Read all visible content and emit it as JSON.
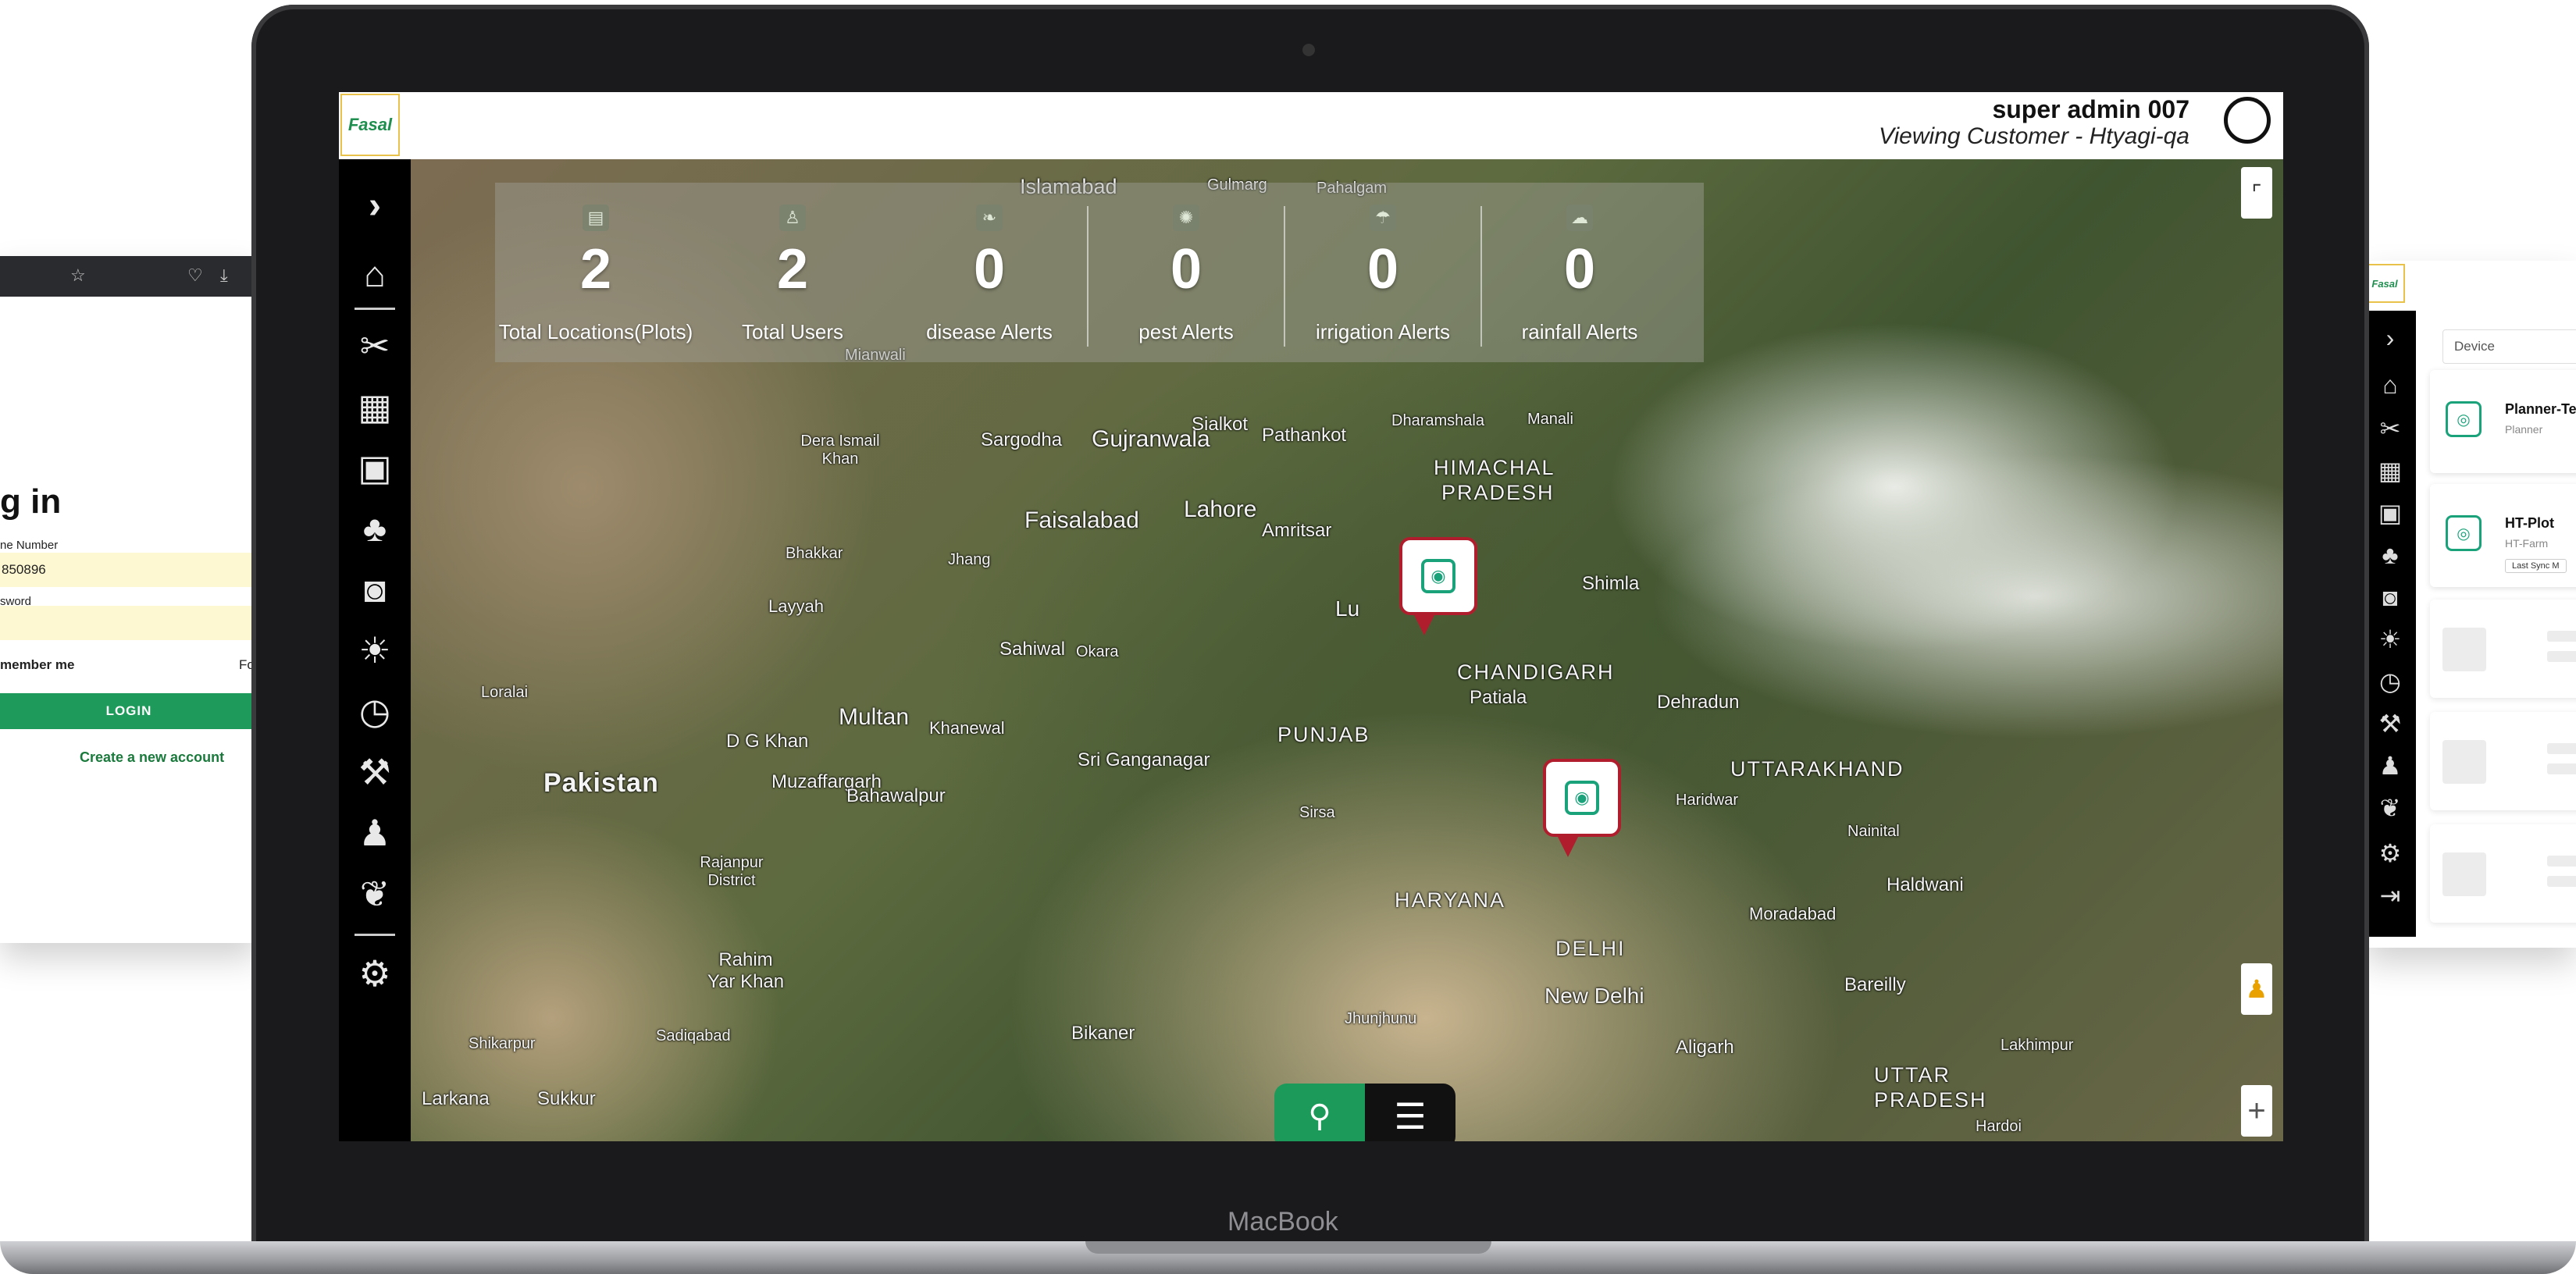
{
  "login": {
    "title": "g in",
    "phone_label": "ne Number",
    "phone_value": "850896",
    "password_label": "sword",
    "remember_label": "member me",
    "forgot_label": "Fo",
    "login_button": "LOGIN",
    "create_account": "Create a new account"
  },
  "laptop": {
    "brand": "MacBook"
  },
  "app": {
    "logo_text": "Fasal",
    "user_name": "super admin 007",
    "viewing_customer": "Viewing Customer - Htyagi-qa"
  },
  "stats": [
    {
      "icon": "plots-icon",
      "value": "2",
      "label": "Total Locations(Plots)"
    },
    {
      "icon": "users-icon",
      "value": "2",
      "label": "Total Users"
    },
    {
      "icon": "disease-icon",
      "value": "0",
      "label": "disease Alerts"
    },
    {
      "icon": "pest-icon",
      "value": "0",
      "label": "pest Alerts"
    },
    {
      "icon": "irrigation-icon",
      "value": "0",
      "label": "irrigation Alerts"
    },
    {
      "icon": "rainfall-icon",
      "value": "0",
      "label": "rainfall Alerts"
    }
  ],
  "map_labels": {
    "islamabad": "Islamabad",
    "gulmarg": "Gulmarg",
    "pahalgam": "Pahalgam",
    "mianwali": "Mianwali",
    "dera_ismail_khan": "Dera Ismail Khan",
    "sargodha": "Sargodha",
    "gujranwala": "Gujranwala",
    "sialkot": "Sialkot",
    "pathankot": "Pathankot",
    "dharamshala": "Dharamshala",
    "manali": "Manali",
    "himachal": "HIMACHAL",
    "pradesh": "PRADESH",
    "faisalabad": "Faisalabad",
    "lahore": "Lahore",
    "amritsar": "Amritsar",
    "bhakkar": "Bhakkar",
    "jhang": "Jhang",
    "layyah": "Layyah",
    "ludhiana": "Lu",
    "shimla": "Shimla",
    "sahiwal": "Sahiwal",
    "okara": "Okara",
    "chandigarh": "CHANDIGARH",
    "patiala": "Patiala",
    "dehradun": "Dehradun",
    "loralai": "Loralai",
    "multan": "Multan",
    "khanewal": "Khanewal",
    "dg_khan": "D G Khan",
    "punjab": "PUNJAB",
    "pakistan": "Pakistan",
    "muzaffargarh": "Muzaffargarh",
    "sri_ganganagar": "Sri Ganganagar",
    "uttarakhand": "UTTARAKHAND",
    "haridwar": "Haridwar",
    "nainital": "Nainital",
    "bahawalpur": "Bahawalpur",
    "sirsa": "Sirsa",
    "haldwani": "Haldwani",
    "rajanpur": "Rajanpur District",
    "haryana": "HARYANA",
    "moradabad": "Moradabad",
    "rahim_yar_khan": "Rahim Yar Khan",
    "delhi": "DELHI",
    "new_delhi": "New Delhi",
    "bareilly": "Bareilly",
    "shikarpur": "Shikarpur",
    "sadiqabad": "Sadiqabad",
    "bikaner": "Bikaner",
    "jhunjhunu": "Jhunjhunu",
    "aligarh": "Aligarh",
    "lakhimpur": "Lakhimpur",
    "uttar": "UTTAR",
    "uttar_pradesh": "PRADESH",
    "larkana": "Larkana",
    "sukkur": "Sukkur",
    "hardoi": "Hardoi"
  },
  "right_panel": {
    "logo_text": "Fasal",
    "device_placeholder": "Device",
    "cards": [
      {
        "title": "Planner-Te",
        "subtitle": "Planner",
        "badge": ""
      },
      {
        "title": "HT-Plot",
        "subtitle": "HT-Farm",
        "badge": "Last Sync M"
      }
    ]
  }
}
